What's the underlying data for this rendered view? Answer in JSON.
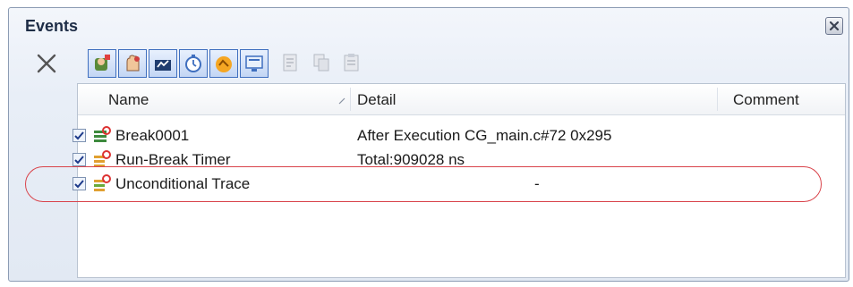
{
  "window": {
    "title": "Events"
  },
  "toolbar": {
    "buttons": [
      {
        "icon": "delete-icon",
        "enabled": true
      },
      {
        "icon": "hardware-break-icon",
        "enabled": true,
        "active": true
      },
      {
        "icon": "software-break-icon",
        "enabled": true,
        "active": true
      },
      {
        "icon": "trace-event-icon",
        "enabled": true,
        "active": true
      },
      {
        "icon": "timer-event-icon",
        "enabled": true,
        "active": true
      },
      {
        "icon": "action-event-icon",
        "enabled": true,
        "active": true
      },
      {
        "icon": "display-event-icon",
        "enabled": true,
        "active": true
      },
      {
        "icon": "edit-condition-icon",
        "enabled": false
      },
      {
        "icon": "copy-event-icon",
        "enabled": false
      },
      {
        "icon": "paste-event-icon",
        "enabled": false
      }
    ]
  },
  "table": {
    "columns": {
      "name": "Name",
      "detail": "Detail",
      "comment": "Comment"
    },
    "rows": [
      {
        "checked": true,
        "icon": "break-event-icon",
        "name": "Break0001",
        "detail": "After Execution  CG_main.c#72 0x295",
        "comment": ""
      },
      {
        "checked": true,
        "icon": "timer-result-icon",
        "name": "Run-Break Timer",
        "detail": "Total:909028 ns",
        "comment": ""
      },
      {
        "checked": true,
        "icon": "trace-result-icon",
        "name": "Unconditional Trace",
        "detail": "-",
        "comment": ""
      }
    ]
  },
  "colors": {
    "highlight": "#d9434a",
    "accent": "#3f6fbf"
  }
}
